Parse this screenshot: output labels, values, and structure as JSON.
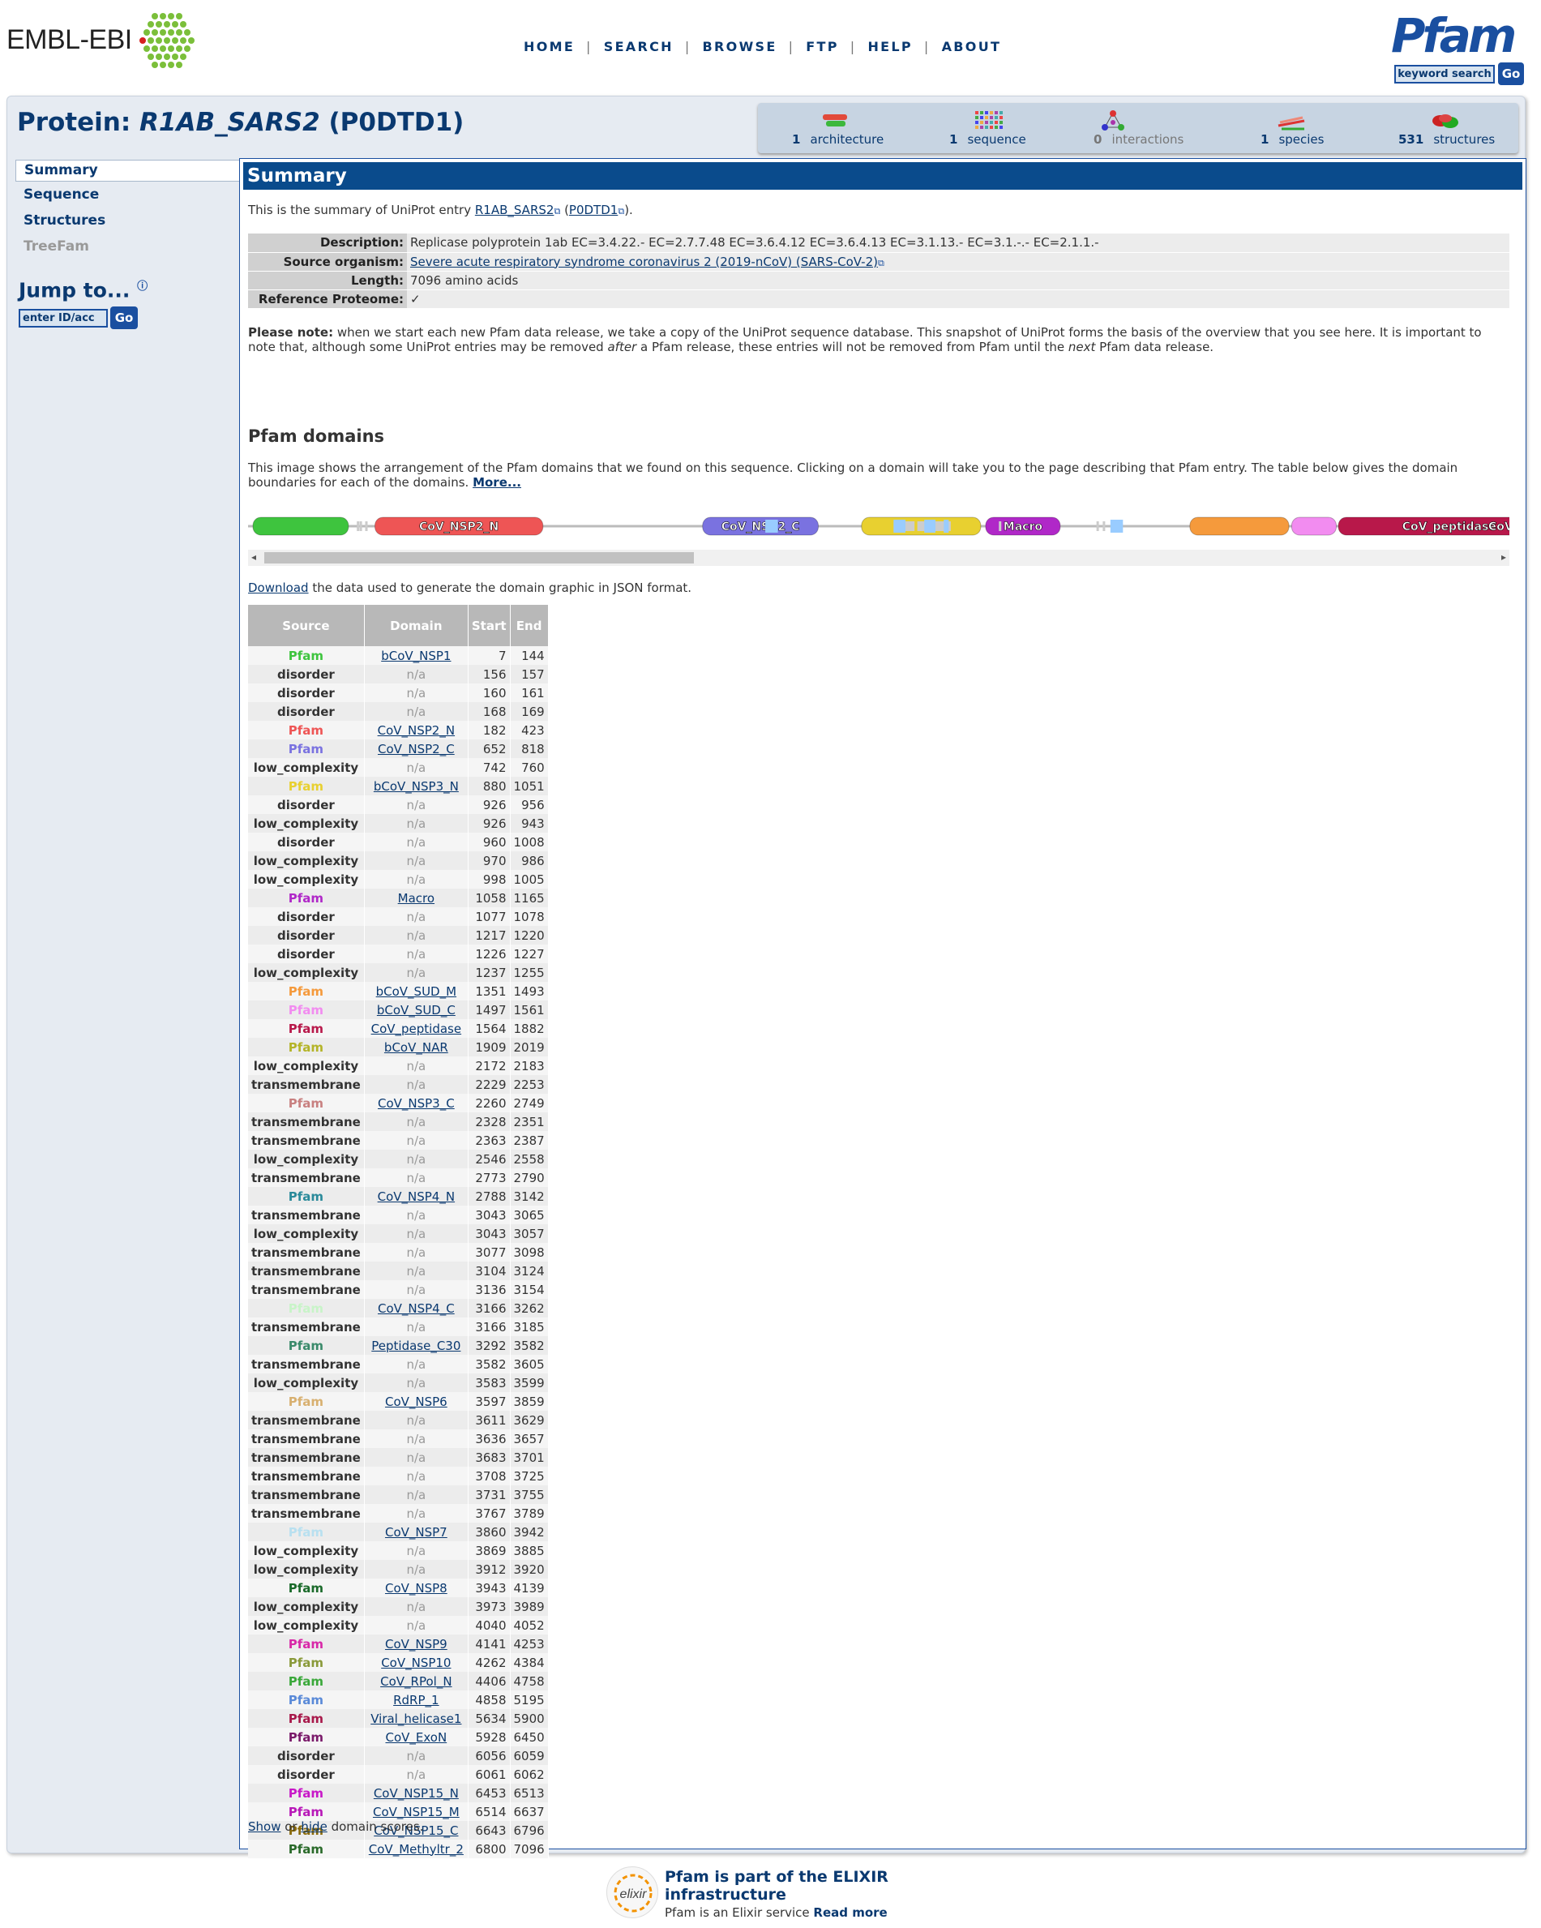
{
  "header": {
    "ebi_logo_text": "EMBL-EBI",
    "nav": [
      "HOME",
      "SEARCH",
      "BROWSE",
      "FTP",
      "HELP",
      "ABOUT"
    ],
    "pfam_logo": "Pfam",
    "keyword_search": "keyword search",
    "go": "Go"
  },
  "title": {
    "prefix": "Protein: ",
    "entry": "R1AB_SARS2",
    "acc": "(P0DTD1)"
  },
  "icon_bar": [
    {
      "count": "1",
      "label": "architecture"
    },
    {
      "count": "1",
      "label": "sequence"
    },
    {
      "count": "0",
      "label": "interactions"
    },
    {
      "count": "1",
      "label": "species"
    },
    {
      "count": "531",
      "label": "structures"
    }
  ],
  "sidebar": {
    "items": [
      "Summary",
      "Sequence",
      "Structures",
      "TreeFam"
    ],
    "jump_label": "Jump to...",
    "jump_placeholder": "enter ID/acc",
    "jump_go": "Go"
  },
  "summary": {
    "heading": "Summary",
    "intro_pre": "This is the summary of UniProt entry ",
    "intro_entry": "R1AB_SARS2",
    "intro_acc": "P0DTD1",
    "intro_post": ").",
    "details": [
      {
        "key": "Description:",
        "value": "Replicase polyprotein 1ab EC=3.4.22.- EC=2.7.7.48 EC=3.6.4.12 EC=3.6.4.13 EC=3.1.13.- EC=3.1.-.- EC=2.1.1.-"
      },
      {
        "key": "Source organism:",
        "value": "Severe acute respiratory syndrome coronavirus 2 (2019-nCoV) (SARS-CoV-2)"
      },
      {
        "key": "Length:",
        "value": "7096 amino acids"
      },
      {
        "key": "Reference Proteome:",
        "value": "✓"
      }
    ],
    "note_bold": "Please note:",
    "note_1": " when we start each new Pfam data release, we take a copy of the UniProt sequence database. This snapshot of UniProt forms the basis of the overview that you see here. It is important to note that, although some UniProt entries may be removed ",
    "note_after": "after",
    "note_2": " a Pfam release, these entries will not be removed from Pfam until the ",
    "note_next": "next",
    "note_3": " Pfam data release.",
    "domains_heading": "Pfam domains",
    "domains_text": "This image shows the arrangement of the Pfam domains that we found on this sequence. Clicking on a domain will take you to the page describing that Pfam entry. The table below gives the domain boundaries for each of the domains.",
    "more": "More...",
    "download_link": "Download",
    "download_text": " the data used to generate the domain graphic in JSON format.",
    "show": "Show",
    "or": " or ",
    "hide": "hide",
    "scores_text": " domain scores."
  },
  "graphic_labels": [
    "CoV_NSP2_N",
    "CoV_NSP2_C",
    "Macro",
    "CoV_peptidase",
    "CoV_"
  ],
  "table": {
    "headers": [
      "Source",
      "Domain",
      "Start",
      "End"
    ],
    "rows": [
      [
        "Pfam",
        "bCoV_NSP1",
        "7",
        "144",
        "#3ec43e"
      ],
      [
        "disorder",
        "n/a",
        "156",
        "157",
        ""
      ],
      [
        "disorder",
        "n/a",
        "160",
        "161",
        ""
      ],
      [
        "disorder",
        "n/a",
        "168",
        "169",
        ""
      ],
      [
        "Pfam",
        "CoV_NSP2_N",
        "182",
        "423",
        "#ee5555"
      ],
      [
        "Pfam",
        "CoV_NSP2_C",
        "652",
        "818",
        "#7a72e0"
      ],
      [
        "low_complexity",
        "n/a",
        "742",
        "760",
        ""
      ],
      [
        "Pfam",
        "bCoV_NSP3_N",
        "880",
        "1051",
        "#e8d030"
      ],
      [
        "disorder",
        "n/a",
        "926",
        "956",
        ""
      ],
      [
        "low_complexity",
        "n/a",
        "926",
        "943",
        ""
      ],
      [
        "disorder",
        "n/a",
        "960",
        "1008",
        ""
      ],
      [
        "low_complexity",
        "n/a",
        "970",
        "986",
        ""
      ],
      [
        "low_complexity",
        "n/a",
        "998",
        "1005",
        ""
      ],
      [
        "Pfam",
        "Macro",
        "1058",
        "1165",
        "#b028c8"
      ],
      [
        "disorder",
        "n/a",
        "1077",
        "1078",
        ""
      ],
      [
        "disorder",
        "n/a",
        "1217",
        "1220",
        ""
      ],
      [
        "disorder",
        "n/a",
        "1226",
        "1227",
        ""
      ],
      [
        "low_complexity",
        "n/a",
        "1237",
        "1255",
        ""
      ],
      [
        "Pfam",
        "bCoV_SUD_M",
        "1351",
        "1493",
        "#f59a3c"
      ],
      [
        "Pfam",
        "bCoV_SUD_C",
        "1497",
        "1561",
        "#f28cf0"
      ],
      [
        "Pfam",
        "CoV_peptidase",
        "1564",
        "1882",
        "#b8184a"
      ],
      [
        "Pfam",
        "bCoV_NAR",
        "1909",
        "2019",
        "#b4b428"
      ],
      [
        "low_complexity",
        "n/a",
        "2172",
        "2183",
        ""
      ],
      [
        "transmembrane",
        "n/a",
        "2229",
        "2253",
        ""
      ],
      [
        "Pfam",
        "CoV_NSP3_C",
        "2260",
        "2749",
        "#c88080"
      ],
      [
        "transmembrane",
        "n/a",
        "2328",
        "2351",
        ""
      ],
      [
        "transmembrane",
        "n/a",
        "2363",
        "2387",
        ""
      ],
      [
        "low_complexity",
        "n/a",
        "2546",
        "2558",
        ""
      ],
      [
        "transmembrane",
        "n/a",
        "2773",
        "2790",
        ""
      ],
      [
        "Pfam",
        "CoV_NSP4_N",
        "2788",
        "3142",
        "#2a8a9a"
      ],
      [
        "transmembrane",
        "n/a",
        "3043",
        "3065",
        ""
      ],
      [
        "low_complexity",
        "n/a",
        "3043",
        "3057",
        ""
      ],
      [
        "transmembrane",
        "n/a",
        "3077",
        "3098",
        ""
      ],
      [
        "transmembrane",
        "n/a",
        "3104",
        "3124",
        ""
      ],
      [
        "transmembrane",
        "n/a",
        "3136",
        "3154",
        ""
      ],
      [
        "Pfam",
        "CoV_NSP4_C",
        "3166",
        "3262",
        "#c8f4c8"
      ],
      [
        "transmembrane",
        "n/a",
        "3166",
        "3185",
        ""
      ],
      [
        "Pfam",
        "Peptidase_C30",
        "3292",
        "3582",
        "#3a8a6a"
      ],
      [
        "transmembrane",
        "n/a",
        "3582",
        "3605",
        ""
      ],
      [
        "low_complexity",
        "n/a",
        "3583",
        "3599",
        ""
      ],
      [
        "Pfam",
        "CoV_NSP6",
        "3597",
        "3859",
        "#d8b070"
      ],
      [
        "transmembrane",
        "n/a",
        "3611",
        "3629",
        ""
      ],
      [
        "transmembrane",
        "n/a",
        "3636",
        "3657",
        ""
      ],
      [
        "transmembrane",
        "n/a",
        "3683",
        "3701",
        ""
      ],
      [
        "transmembrane",
        "n/a",
        "3708",
        "3725",
        ""
      ],
      [
        "transmembrane",
        "n/a",
        "3731",
        "3755",
        ""
      ],
      [
        "transmembrane",
        "n/a",
        "3767",
        "3789",
        ""
      ],
      [
        "Pfam",
        "CoV_NSP7",
        "3860",
        "3942",
        "#b8e0f0"
      ],
      [
        "low_complexity",
        "n/a",
        "3869",
        "3885",
        ""
      ],
      [
        "low_complexity",
        "n/a",
        "3912",
        "3920",
        ""
      ],
      [
        "Pfam",
        "CoV_NSP8",
        "3943",
        "4139",
        "#1a6a2a"
      ],
      [
        "low_complexity",
        "n/a",
        "3973",
        "3989",
        ""
      ],
      [
        "low_complexity",
        "n/a",
        "4040",
        "4052",
        ""
      ],
      [
        "Pfam",
        "CoV_NSP9",
        "4141",
        "4253",
        "#d828a8"
      ],
      [
        "Pfam",
        "CoV_NSP10",
        "4262",
        "4384",
        "#8a9a3a"
      ],
      [
        "Pfam",
        "CoV_RPol_N",
        "4406",
        "4758",
        "#3aa83a"
      ],
      [
        "Pfam",
        "RdRP_1",
        "4858",
        "5195",
        "#5a8ad8"
      ],
      [
        "Pfam",
        "Viral_helicase1",
        "5634",
        "5900",
        "#a8184a"
      ],
      [
        "Pfam",
        "CoV_ExoN",
        "5928",
        "6450",
        "#7a1a6a"
      ],
      [
        "disorder",
        "n/a",
        "6056",
        "6059",
        ""
      ],
      [
        "disorder",
        "n/a",
        "6061",
        "6062",
        ""
      ],
      [
        "Pfam",
        "CoV_NSP15_N",
        "6453",
        "6513",
        "#c818c8"
      ],
      [
        "Pfam",
        "CoV_NSP15_M",
        "6514",
        "6637",
        "#b818b8"
      ],
      [
        "Pfam",
        "CoV_NSP15_C",
        "6643",
        "6796",
        "#8a6a0a"
      ],
      [
        "Pfam",
        "CoV_Methyltr_2",
        "6800",
        "7096",
        "#2a6a2a"
      ]
    ]
  },
  "footer": {
    "heading": "Pfam is part of the ELIXIR infrastructure",
    "sub_pre": "Pfam is an Elixir service ",
    "read_more": "Read more",
    "logo_text": "elixir"
  }
}
